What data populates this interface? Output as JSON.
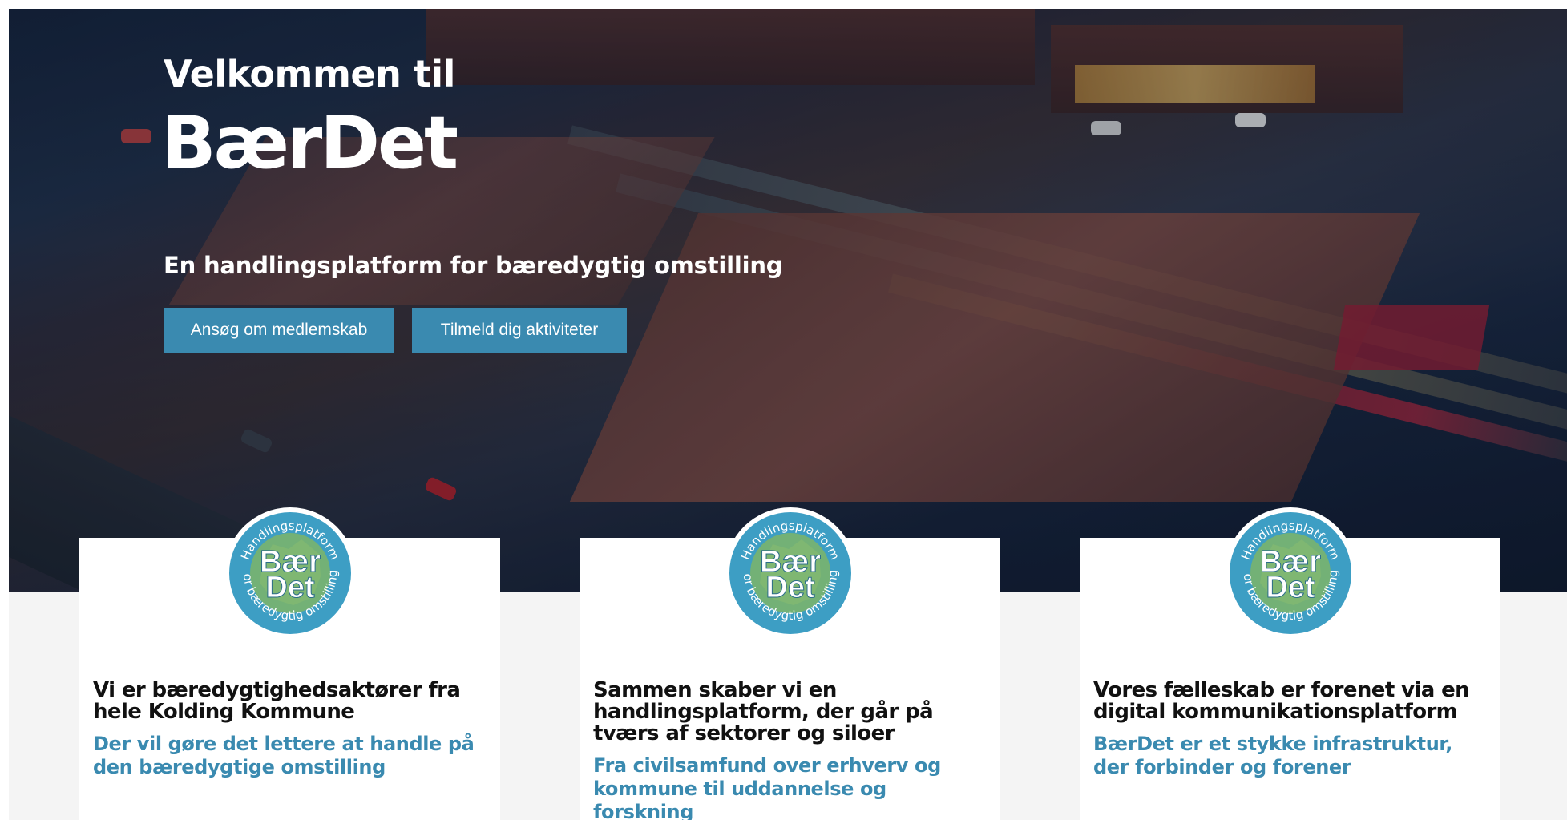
{
  "hero": {
    "welcome": "Velkommen til",
    "brand": "BærDet",
    "tagline": "En handlingsplatform for bæredygtig omstilling",
    "buttons": [
      {
        "label": "Ansøg om medlemskab"
      },
      {
        "label": "Tilmeld dig aktiviteter"
      }
    ]
  },
  "logo": {
    "top_text": "Handlingsplatform",
    "name_line1": "Bær",
    "name_line2": "Det",
    "bottom_text": "for bæredygtig omstilling"
  },
  "cards": [
    {
      "title": "Vi er bæredygtighedsaktører fra hele Kolding Kommune",
      "subtitle": "Der vil gøre det lettere at handle på den bæredygtige omstilling"
    },
    {
      "title": "Sammen skaber vi en handlingsplatform, der går på tværs af sektorer og siloer",
      "subtitle": "Fra civilsamfund over erhverv og kommune til uddannelse og forskning"
    },
    {
      "title": "Vores fælleskab er forenet via en digital kommunikationsplatform",
      "subtitle": "BærDet er et stykke infrastruktur, der forbinder og forener"
    }
  ],
  "colors": {
    "accent": "#3a8ab0",
    "logo_outer": "#ffffff",
    "logo_ring": "#3d9ec4",
    "logo_land": "#79b26e"
  }
}
